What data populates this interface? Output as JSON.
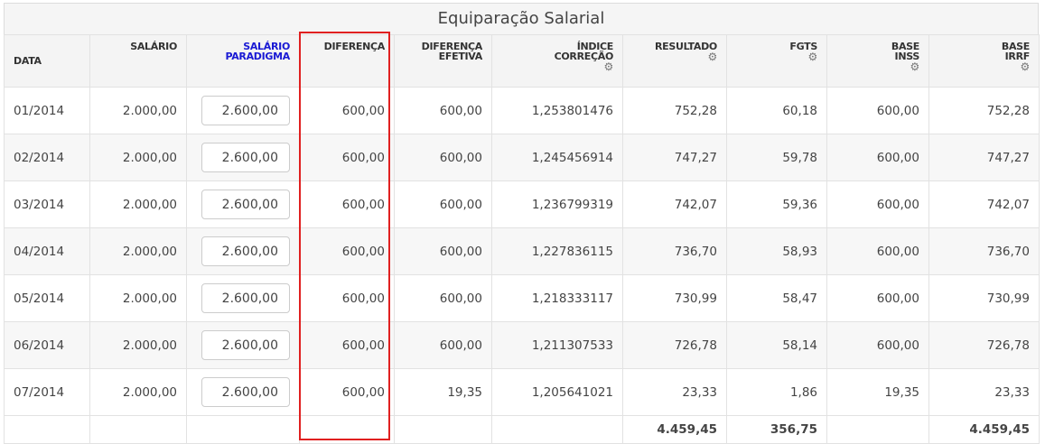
{
  "title": "Equiparação Salarial",
  "headers": {
    "data": "DATA",
    "salario": "SALÁRIO",
    "salario_paradigma_1": "SALÁRIO",
    "salario_paradigma_2": "PARADIGMA",
    "diferenca": "DIFERENÇA",
    "diferenca_efetiva_1": "DIFERENÇA",
    "diferenca_efetiva_2": "EFETIVA",
    "indice_correcao_1": "ÍNDICE",
    "indice_correcao_2": "CORREÇÃO",
    "resultado": "RESULTADO",
    "fgts": "FGTS",
    "base_inss_1": "BASE",
    "base_inss_2": "INSS",
    "base_irrf_1": "BASE",
    "base_irrf_2": "IRRF"
  },
  "icons": {
    "settings": "gear-icon"
  },
  "highlight_color": "#e02020",
  "rows": [
    {
      "data": "01/2014",
      "salario": "2.000,00",
      "paradigma": "2.600,00",
      "diferenca": "600,00",
      "efetiva": "600,00",
      "indice": "1,253801476",
      "resultado": "752,28",
      "fgts": "60,18",
      "inss": "600,00",
      "irrf": "752,28"
    },
    {
      "data": "02/2014",
      "salario": "2.000,00",
      "paradigma": "2.600,00",
      "diferenca": "600,00",
      "efetiva": "600,00",
      "indice": "1,245456914",
      "resultado": "747,27",
      "fgts": "59,78",
      "inss": "600,00",
      "irrf": "747,27"
    },
    {
      "data": "03/2014",
      "salario": "2.000,00",
      "paradigma": "2.600,00",
      "diferenca": "600,00",
      "efetiva": "600,00",
      "indice": "1,236799319",
      "resultado": "742,07",
      "fgts": "59,36",
      "inss": "600,00",
      "irrf": "742,07"
    },
    {
      "data": "04/2014",
      "salario": "2.000,00",
      "paradigma": "2.600,00",
      "diferenca": "600,00",
      "efetiva": "600,00",
      "indice": "1,227836115",
      "resultado": "736,70",
      "fgts": "58,93",
      "inss": "600,00",
      "irrf": "736,70"
    },
    {
      "data": "05/2014",
      "salario": "2.000,00",
      "paradigma": "2.600,00",
      "diferenca": "600,00",
      "efetiva": "600,00",
      "indice": "1,218333117",
      "resultado": "730,99",
      "fgts": "58,47",
      "inss": "600,00",
      "irrf": "730,99"
    },
    {
      "data": "06/2014",
      "salario": "2.000,00",
      "paradigma": "2.600,00",
      "diferenca": "600,00",
      "efetiva": "600,00",
      "indice": "1,211307533",
      "resultado": "726,78",
      "fgts": "58,14",
      "inss": "600,00",
      "irrf": "726,78"
    },
    {
      "data": "07/2014",
      "salario": "2.000,00",
      "paradigma": "2.600,00",
      "diferenca": "600,00",
      "efetiva": "19,35",
      "indice": "1,205641021",
      "resultado": "23,33",
      "fgts": "1,86",
      "inss": "19,35",
      "irrf": "23,33"
    }
  ],
  "totals": {
    "resultado": "4.459,45",
    "fgts": "356,75",
    "irrf": "4.459,45"
  }
}
